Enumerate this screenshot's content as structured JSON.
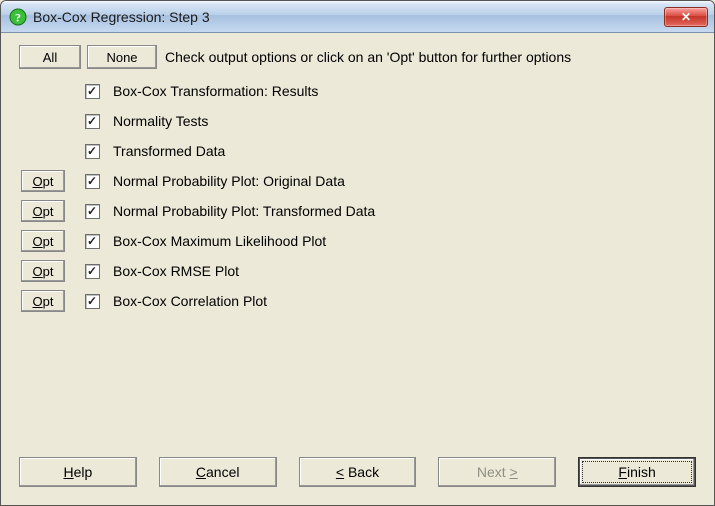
{
  "window": {
    "title": "Box-Cox Regression: Step 3"
  },
  "toolbar": {
    "all": "All",
    "none": "None",
    "instruction": "Check output options or click on an 'Opt' button for further options"
  },
  "opt_button_label": "Opt",
  "options": [
    {
      "label": "Box-Cox Transformation: Results",
      "checked": true,
      "has_opt": false
    },
    {
      "label": "Normality Tests",
      "checked": true,
      "has_opt": false
    },
    {
      "label": "Transformed Data",
      "checked": true,
      "has_opt": false
    },
    {
      "label": "Normal Probability Plot: Original Data",
      "checked": true,
      "has_opt": true
    },
    {
      "label": "Normal Probability Plot: Transformed Data",
      "checked": true,
      "has_opt": true
    },
    {
      "label": "Box-Cox Maximum Likelihood Plot",
      "checked": true,
      "has_opt": true
    },
    {
      "label": "Box-Cox RMSE Plot",
      "checked": true,
      "has_opt": true
    },
    {
      "label": "Box-Cox Correlation Plot",
      "checked": true,
      "has_opt": true
    }
  ],
  "footer": {
    "help": {
      "pre": "",
      "u": "H",
      "post": "elp"
    },
    "cancel": {
      "pre": "",
      "u": "C",
      "post": "ancel"
    },
    "back": {
      "pre": "",
      "u": "<",
      "post": " Back"
    },
    "next": {
      "pre": "Next ",
      "u": ">",
      "post": ""
    },
    "finish": {
      "pre": "",
      "u": "F",
      "post": "inish"
    },
    "next_enabled": false
  }
}
